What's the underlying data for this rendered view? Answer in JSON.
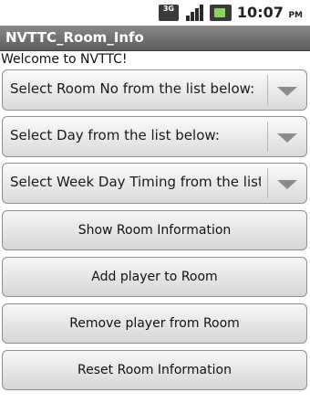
{
  "status_bar": {
    "network_label": "3G",
    "time": "10:07",
    "ampm": "PM",
    "icons": [
      "network-3g-icon",
      "signal-strength-icon",
      "battery-icon"
    ]
  },
  "app": {
    "title": "NVTTC_Room_Info",
    "welcome": "Welcome to NVTTC!"
  },
  "spinners": {
    "room": "Select Room No from the list below:",
    "day": "Select Day from the list below:",
    "week_day_timing": "Select Week Day Timing from the list below:"
  },
  "buttons": {
    "show_room_info": "Show Room Information",
    "add_player": "Add player to Room",
    "remove_player": "Remove player from Room",
    "reset_room_info": "Reset Room Information"
  }
}
